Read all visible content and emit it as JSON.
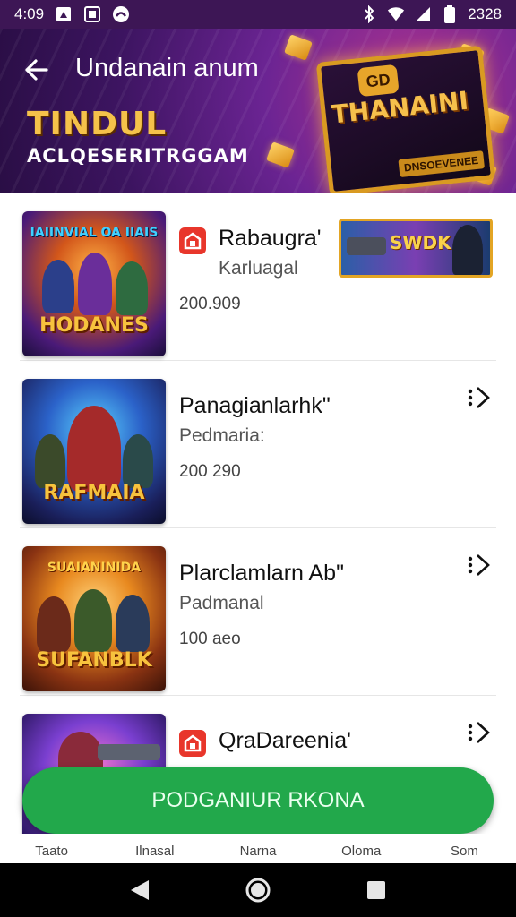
{
  "status_bar": {
    "time": "4:09",
    "battery_text": "2328",
    "left_icons": [
      "media-icon",
      "notification-icon",
      "ring-icon"
    ],
    "right_icons": [
      "bluetooth-icon",
      "wifi-icon",
      "signal-icon",
      "battery-icon"
    ]
  },
  "header": {
    "title": "Undanain anum",
    "promo_title": "TINDUL",
    "promo_subtitle": "ACLQESERITRGGAM",
    "promo_art_title": "THANAINI",
    "promo_art_badge": "DNSOEVENEE",
    "promo_art_seal": "GD"
  },
  "games": [
    {
      "name": "Rabaugra'",
      "developer": "Karluagal",
      "count": "200.909",
      "thumb_label": "HODANES",
      "thumb_top": "IAIINVIAL OA IIAIS",
      "has_icon": true,
      "has_banner": true,
      "banner_text": "SWDK"
    },
    {
      "name": "Panagianlarhk\"",
      "developer": "Pedmaria:",
      "count": "200 290",
      "thumb_label": "RAFMAIA",
      "thumb_top": "",
      "has_icon": false
    },
    {
      "name": "Plarclamlarn Ab\"",
      "developer": "Padmanal",
      "count": "100 aeo",
      "thumb_label": "SUFANBLK",
      "thumb_top": "SUAIANINIDA",
      "has_icon": false
    },
    {
      "name": "QraDareenia'",
      "developer": "",
      "count": "",
      "thumb_label": "",
      "thumb_top": "",
      "has_icon": true
    }
  ],
  "cta": {
    "label": "PODGANIUR RKONA"
  },
  "bottom_nav": [
    "Taato",
    "Ilnasal",
    "Narna",
    "Oloma",
    "Som"
  ],
  "colors": {
    "accent": "#22a84b",
    "header": "#4a1a6e",
    "gold": "#f5c24a"
  }
}
